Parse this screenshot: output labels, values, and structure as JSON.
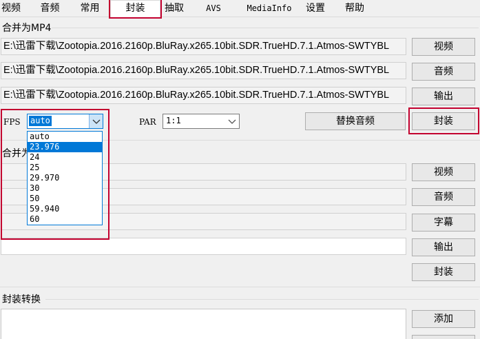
{
  "tabs": [
    {
      "id": "video",
      "label": "视频"
    },
    {
      "id": "audio",
      "label": "音频"
    },
    {
      "id": "common",
      "label": "常用"
    },
    {
      "id": "mux",
      "label": "封装"
    },
    {
      "id": "extract",
      "label": "抽取"
    },
    {
      "id": "avs",
      "label": "AVS"
    },
    {
      "id": "mediainfo",
      "label": "MediaInfo"
    },
    {
      "id": "settings",
      "label": "设置"
    },
    {
      "id": "help",
      "label": "帮助"
    }
  ],
  "active_tab": "封装",
  "mp4": {
    "group_label": "合并为MP4",
    "video_path": "E:\\迅雷下载\\Zootopia.2016.2160p.BluRay.x265.10bit.SDR.TrueHD.7.1.Atmos-SWTYBL",
    "audio_path": "E:\\迅雷下载\\Zootopia.2016.2160p.BluRay.x265.10bit.SDR.TrueHD.7.1.Atmos-SWTYBL",
    "output_path": "E:\\迅雷下载\\Zootopia.2016.2160p.BluRay.x265.10bit.SDR.TrueHD.7.1.Atmos-SWTYBL",
    "video_button": "视频",
    "audio_button": "音频",
    "output_button": "输出",
    "fps_label": "FPS",
    "fps_value": "auto",
    "fps_options": [
      "auto",
      "23.976",
      "24",
      "25",
      "29.970",
      "30",
      "50",
      "59.940",
      "60"
    ],
    "fps_highlighted": "23.976",
    "par_label": "PAR",
    "par_value": "1:1",
    "replace_audio_button": "替换音频",
    "mux_button": "封装"
  },
  "mkv": {
    "group_label_partial": "合并为",
    "video_button": "视频",
    "audio_button": "音频",
    "subtitle_button": "字幕",
    "output_button": "输出",
    "mux_button": "封装"
  },
  "convert": {
    "group_label": "封装转换",
    "add_button": "添加"
  },
  "colors": {
    "highlight": "#c3002f",
    "selection": "#0078d7"
  }
}
